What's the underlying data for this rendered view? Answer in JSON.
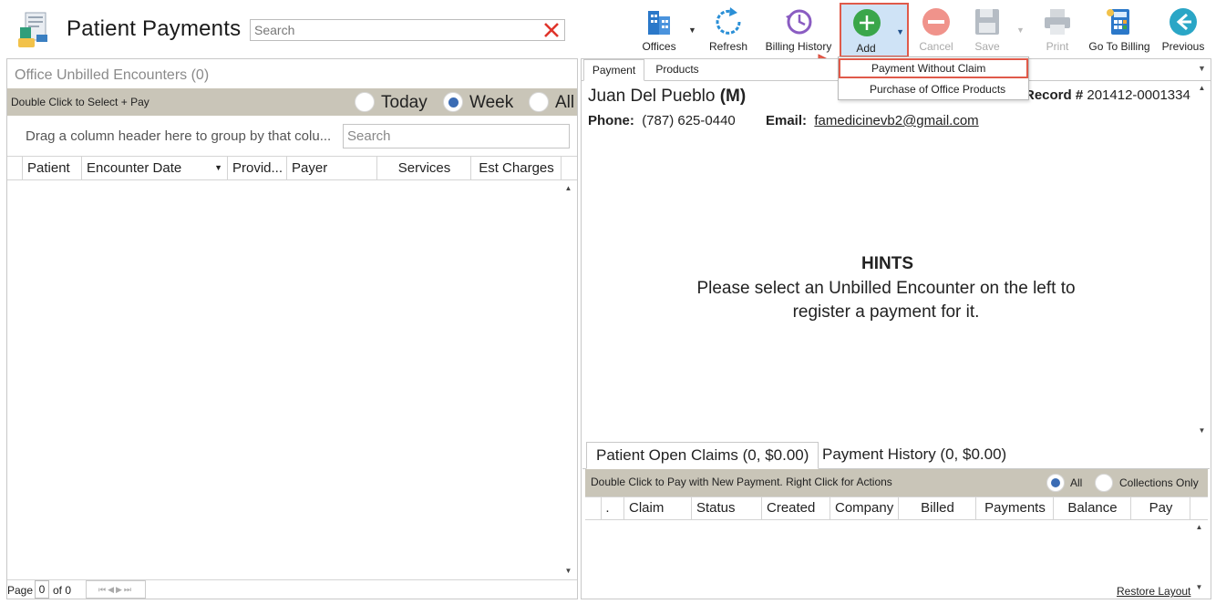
{
  "header": {
    "title": "Patient Payments",
    "search_placeholder": "Search",
    "app_icon": "patient-payments-icon",
    "clear_icon": "close-icon"
  },
  "toolbar": {
    "offices": "Offices",
    "refresh": "Refresh",
    "billing_history": "Billing History",
    "add": "Add",
    "cancel": "Cancel",
    "save": "Save",
    "print": "Print",
    "go_to_billing": "Go To Billing",
    "previous": "Previous"
  },
  "add_menu": {
    "items": [
      "Payment Without Claim",
      "Purchase of Office Products"
    ]
  },
  "left": {
    "title": "Office Unbilled Encounters (0)",
    "hint": "Double Click to Select + Pay",
    "filters": [
      "Today",
      "Week",
      "All"
    ],
    "selected_filter": "Week",
    "group_hint": "Drag a column header here to group by that colu...",
    "search_placeholder": "Search",
    "columns": [
      "Patient",
      "Encounter Date",
      "Provid...",
      "Payer",
      "Services",
      "Est Charges"
    ],
    "pager": {
      "page_label": "Page",
      "page_value": "0",
      "of_label": "of 0"
    }
  },
  "right": {
    "tabs": [
      "Payment",
      "Products"
    ],
    "patient": {
      "name": "Juan Del Pueblo",
      "sex": "(M)",
      "record_label": "Record #",
      "record_value": "201412-0001334",
      "phone_label": "Phone:",
      "phone_value": "(787) 625-0440",
      "email_label": "Email:",
      "email_value": "famedicinevb2@gmail.com"
    },
    "hints": {
      "title": "HINTS",
      "line1": "Please select an Unbilled Encounter on the left to",
      "line2": "register a payment for it."
    },
    "bottom_tabs": [
      "Patient Open Claims (0, $0.00)",
      "Payment History (0, $0.00)"
    ],
    "grid_hint": "Double Click to Pay with New Payment. Right Click for Actions",
    "grid_filters": [
      "All",
      "Collections Only"
    ],
    "selected_grid_filter": "All",
    "columns": [
      ".",
      "Claim",
      "Status",
      "Created",
      "Company",
      "Billed",
      "Payments",
      "Balance",
      "Pay"
    ],
    "restore_layout": "Restore Layout"
  },
  "colors": {
    "accent_red": "#e05a4a",
    "radio_blue": "#3b6cb4",
    "bar_gray": "#c9c5b8",
    "add_green": "#3aa64a",
    "cancel_red": "#e8675c"
  }
}
